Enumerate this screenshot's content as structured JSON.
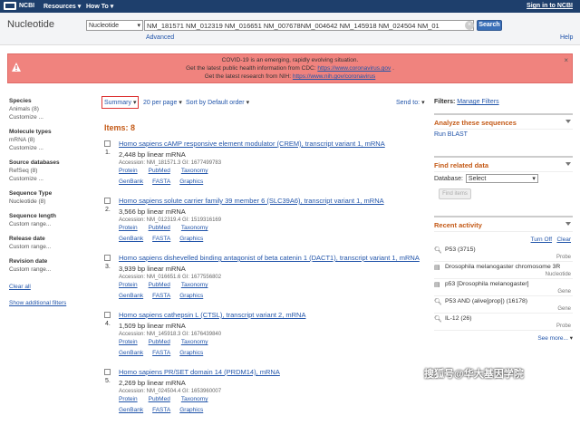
{
  "topbar": {
    "brand": "NCBI",
    "resources": "Resources",
    "howto": "How To",
    "signin": "Sign in to NCBI"
  },
  "header": {
    "db_name": "Nucleotide",
    "db_select": "Nucleotide",
    "query": "NM_181571 NM_012319 NM_016651 NM_007678NM_004642 NM_145918 NM_024504 NM_01",
    "search_label": "Search",
    "advanced": "Advanced",
    "help": "Help"
  },
  "alert": {
    "line1": "COVID-19 is an emerging, rapidly evolving situation.",
    "line2_prefix": "Get the latest public health information from CDC: ",
    "line2_link": "https://www.coronavirus.gov",
    "line2_suffix": " .",
    "line3_prefix": "Get the latest research from NIH: ",
    "line3_link": "https://www.nih.gov/coronavirus"
  },
  "sidebar": {
    "groups": [
      {
        "title": "Species",
        "items": [
          "Animals (8)",
          "Customize ..."
        ]
      },
      {
        "title": "Molecule types",
        "items": [
          "mRNA (8)",
          "Customize ..."
        ]
      },
      {
        "title": "Source databases",
        "items": [
          "RefSeq (8)",
          "Customize ..."
        ]
      },
      {
        "title": "Sequence Type",
        "items": [
          "Nucleotide (8)"
        ]
      },
      {
        "title": "Sequence length",
        "items": [
          "Custom range..."
        ]
      },
      {
        "title": "Release date",
        "items": [
          "Custom range..."
        ]
      },
      {
        "title": "Revision date",
        "items": [
          "Custom range..."
        ]
      }
    ],
    "clear_all": "Clear all",
    "show_filters": "Show additional filters"
  },
  "controls": {
    "summary": "Summary",
    "per_page": "20 per page",
    "sort": "Sort by Default order",
    "send_to": "Send to:"
  },
  "items_count": "Items: 8",
  "results": [
    {
      "num": "1.",
      "title": "Homo sapiens cAMP responsive element modulator (CREM), transcript variant 1, mRNA",
      "desc": "2,448 bp linear mRNA",
      "acc": "Accession: NM_181571.3   GI: 1677499783"
    },
    {
      "num": "2.",
      "title": "Homo sapiens solute carrier family 39 member 6 (SLC39A6), transcript variant 1, mRNA",
      "desc": "3,566 bp linear mRNA",
      "acc": "Accession: NM_012319.4   GI: 1519316169"
    },
    {
      "num": "3.",
      "title": "Homo sapiens dishevelled binding antagonist of beta catenin 1 (DACT1), transcript variant 1, mRNA",
      "desc": "3,939 bp linear mRNA",
      "acc": "Accession: NM_016651.6   GI: 1677556802"
    },
    {
      "num": "4.",
      "title": "Homo sapiens cathepsin L (CTSL), transcript variant 2, mRNA",
      "desc": "1,509 bp linear mRNA",
      "acc": "Accession: NM_145918.3   GI: 1676439840"
    },
    {
      "num": "5.",
      "title": "Homo sapiens PR/SET domain 14 (PRDM14), mRNA",
      "desc": "2,269 bp linear mRNA",
      "acc": "Accession: NM_024504.4   GI: 1653960007"
    }
  ],
  "result_links": {
    "protein": "Protein",
    "pubmed": "PubMed",
    "taxonomy": "Taxonomy",
    "genbank": "GenBank",
    "fasta": "FASTA",
    "graphics": "Graphics"
  },
  "right": {
    "filters_label": "Filters:",
    "manage_filters": "Manage Filters",
    "analyze_title": "Analyze these sequences",
    "run_blast": "Run BLAST",
    "related_title": "Find related data",
    "database_label": "Database:",
    "database_value": "Select",
    "find_items": "Find items",
    "recent_title": "Recent activity",
    "turn_off": "Turn Off",
    "clear": "Clear",
    "recent": [
      {
        "icon": "search-icon",
        "text": "P53 (3715)",
        "src": "Probe"
      },
      {
        "icon": "document-icon",
        "text": "Drosophila melanogaster chromosome 3R",
        "src": "Nucleotide"
      },
      {
        "icon": "document-icon",
        "text": "p53 [Drosophila melanogaster]",
        "src": "Gene"
      },
      {
        "icon": "search-icon",
        "text": "P53 AND (alive[prop]) (16178)",
        "src": "Gene"
      },
      {
        "icon": "search-icon",
        "text": "IL-12 (26)",
        "src": "Probe"
      }
    ],
    "see_more": "See more..."
  },
  "watermark": "搜狐号@华大基因学院",
  "colors": {
    "topbar": "#1e3f6c",
    "alert": "#f0837e",
    "accent": "#c45a17",
    "link": "#2255aa"
  }
}
